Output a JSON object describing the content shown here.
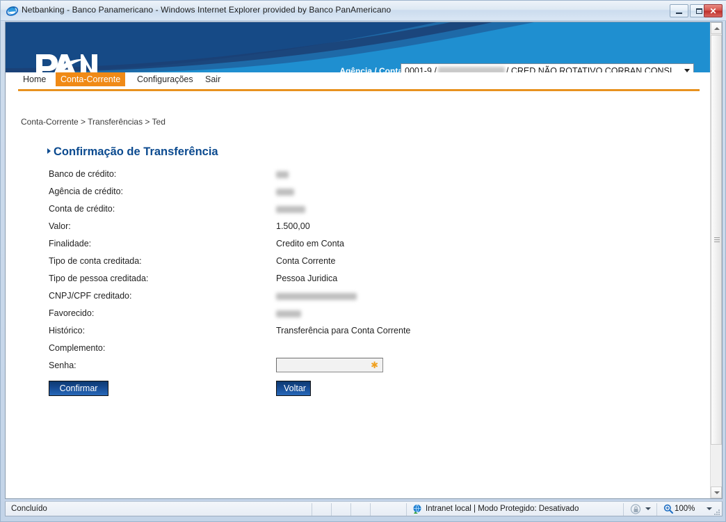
{
  "window": {
    "title": "Netbanking - Banco Panamericano - Windows Internet Explorer provided by Banco PanAmericano",
    "minimize_label": "Minimizar",
    "maximize_label": "Maximizar",
    "close_label": "Fechar"
  },
  "banner": {
    "logo_text": "PAN",
    "account_label": "Agência / Conta:",
    "account_value_prefix": "0001-9 /",
    "account_value_suffix": "/ CRED NÃO ROTATIVO CORBAN CONSI"
  },
  "nav": {
    "items": [
      {
        "label": "Home",
        "active": false
      },
      {
        "label": "Conta-Corrente",
        "active": true
      },
      {
        "label": "Configurações",
        "active": false
      },
      {
        "label": "Sair",
        "active": false
      }
    ]
  },
  "content": {
    "breadcrumb": "Conta-Corrente > Transferências > Ted",
    "page_title": "Confirmação de Transferência",
    "fields": [
      {
        "label": "Banco de crédito:",
        "value": "",
        "redacted": true,
        "redact_width": 18
      },
      {
        "label": "Agência de crédito:",
        "value": "",
        "redacted": true,
        "redact_width": 26
      },
      {
        "label": "Conta de crédito:",
        "value": "",
        "redacted": true,
        "redact_width": 42
      },
      {
        "label": "Valor:",
        "value": "1.500,00",
        "redacted": false
      },
      {
        "label": "Finalidade:",
        "value": "Credito em Conta",
        "redacted": false
      },
      {
        "label": "Tipo de conta creditada:",
        "value": "Conta Corrente",
        "redacted": false
      },
      {
        "label": "Tipo de pessoa creditada:",
        "value": "Pessoa Juridica",
        "redacted": false
      },
      {
        "label": "CNPJ/CPF creditado:",
        "value": "",
        "redacted": true,
        "redact_width": 116
      },
      {
        "label": "Favorecido:",
        "value": "",
        "redacted": true,
        "redact_width": 36
      },
      {
        "label": "Histórico:",
        "value": "Transferência para Conta Corrente",
        "redacted": false
      },
      {
        "label": "Complemento:",
        "value": "",
        "redacted": false
      }
    ],
    "password": {
      "label": "Senha:",
      "value": "",
      "placeholder": "",
      "required_marker": "✱"
    },
    "buttons": {
      "confirm": "Confirmar",
      "back": "Voltar"
    }
  },
  "statusbar": {
    "status": "Concluído",
    "zone": "Intranet local | Modo Protegido: Desativado",
    "zoom": "100%"
  },
  "colors": {
    "accent_orange": "#f08a16",
    "banner_dark_blue": "#1e4f8a",
    "banner_light_blue": "#1f8fd0",
    "title_blue": "#0b4a8f",
    "button_blue": "#14468a",
    "required_star": "#f0a020"
  }
}
